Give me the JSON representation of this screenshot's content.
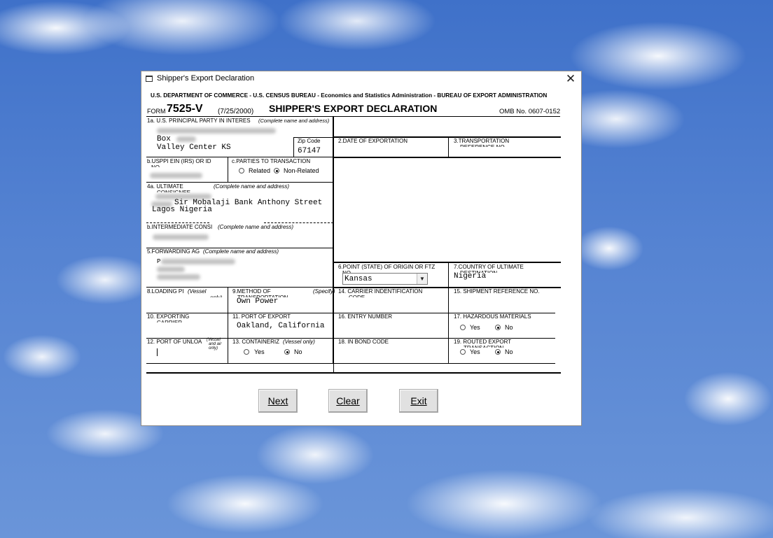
{
  "window": {
    "title": "Shipper's Export Declaration",
    "close_label": "✕"
  },
  "form": {
    "agency_line": "U.S. DEPARTMENT OF COMMERCE - U.S. CENSUS BUREAU - Economics and Statistics Administration - BUREAU OF EXPORT ADMINISTRATION",
    "form_prefix": "FORM",
    "form_number": "7525-V",
    "form_date": "(7/25/2000)",
    "form_title": "SHIPPER'S EXPORT DECLARATION",
    "omb": "OMB No. 0607-0152"
  },
  "fields": {
    "f1a_label": "1a. U.S. PRINCIPAL PARTY IN INTERES",
    "f1a_sub": "(Complete name and address)",
    "f1a_line1": "Box",
    "f1a_line2": "Valley Center KS",
    "zip_label": "Zip Code",
    "zip_value": "67147",
    "f2_label": "2.DATE OF EXPORTATION",
    "f3_label": "3.TRANSPORTATION",
    "f3_label2": "REFERENCE NO.",
    "fb_label": "b.USPPI EIN (IRS) OR ID",
    "fb_label2": "NO.",
    "fc_label": "c.PARTIES TO TRANSACTION",
    "fc_opt_related": "Related",
    "fc_opt_nonrelated": "Non-Related",
    "f4a_label": "4a. ULTIMATE",
    "f4a_label2": "CONSIGNEE",
    "f4a_sub": "(Complete name and address)",
    "f4a_line1": "Sir Mobalaji Bank Anthony Street",
    "f4a_line2": "Lagos Nigeria",
    "f4b_label": "b.INTERMEDIATE CONSI",
    "f4b_sub": "(Complete name and address)",
    "f5_label": "5.FORWARDING AG",
    "f5_sub": "(Complete name and address)",
    "f5_line1": "P",
    "f6_label": "6.POINT (STATE) OF ORIGIN OR FTZ",
    "f6_label2": "NO.",
    "f6_value": "Kansas",
    "f7_label": "7.COUNTRY OF ULTIMATE",
    "f7_label2": "DESTINATION",
    "f7_value": "Nigeria",
    "f8_label": "8.LOADING PI",
    "f8_sub": "(Vessel",
    "f8_sub2": "only)",
    "f9_label": "9.METHOD OF",
    "f9_label2": "TRANSPORTATION",
    "f9_specify": "(Specify)",
    "f9_value": "Own Power",
    "f14_label": "14. CARRIER INDENTIFICATION",
    "f14_label2": "CODE",
    "f15_label": "15. SHIPMENT REFERENCE NO.",
    "f10_label": "10. EXPORTING",
    "f10_label2": "CARRIER",
    "f11_label": "11. PORT OF EXPORT",
    "f11_value": "Oakland, California",
    "f16_label": "16. ENTRY NUMBER",
    "f17_label": "17. HAZARDOUS MATERIALS",
    "f17_yes": "Yes",
    "f17_no": "No",
    "f12_label": "12. PORT OF UNLOA",
    "f12_sub": "(Vessel",
    "f12_sub2": "and air",
    "f12_sub3": "only)",
    "f13_label": "13. CONTAINERIZ",
    "f13_sub": "(Vessel only)",
    "f13_yes": "Yes",
    "f13_no": "No",
    "f18_label": "18. IN BOND CODE",
    "f19_label": "19. ROUTED EXPORT",
    "f19_label2": "TRANSACTION",
    "f19_yes": "Yes",
    "f19_no": "No"
  },
  "buttons": {
    "next": "Next",
    "clear": "Clear",
    "exit": "Exit"
  }
}
